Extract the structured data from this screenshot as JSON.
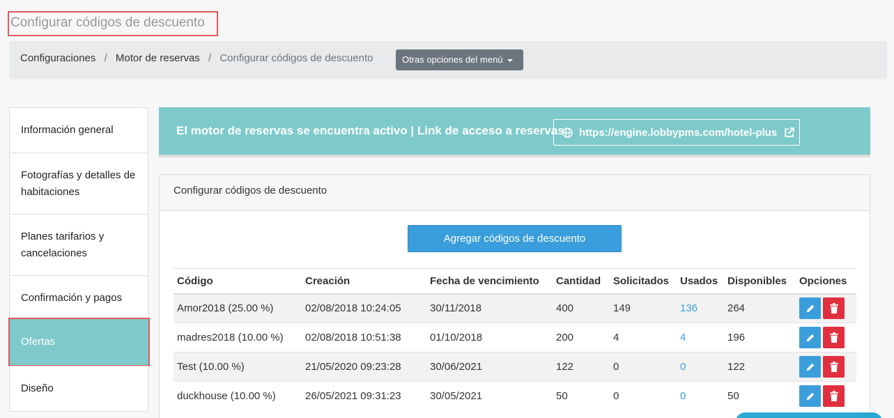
{
  "page_title": "Configurar códigos de descuento",
  "breadcrumb": {
    "items": [
      "Configuraciones",
      "Motor de reservas"
    ],
    "current": "Configurar códigos de descuento",
    "separator": "/"
  },
  "menu_button": {
    "label": "Otras opciones del menú"
  },
  "sidebar": {
    "items": [
      {
        "label": "Información general"
      },
      {
        "label": "Fotografías y detalles de habitaciones"
      },
      {
        "label": "Planes tarifarios y cancelaciones"
      },
      {
        "label": "Confirmación y pagos"
      },
      {
        "label": "Ofertas",
        "active": true
      },
      {
        "label": "Diseño"
      }
    ]
  },
  "banner": {
    "text": "El motor de reservas se encuentra activo | Link de acceso a reservas:",
    "link": "https://engine.lobbypms.com/hotel-plus"
  },
  "card": {
    "header": "Configurar códigos de descuento",
    "add_button": "Agregar códigos de descuento"
  },
  "table": {
    "columns": [
      "Código",
      "Creación",
      "Fecha de vencimiento",
      "Cantidad",
      "Solicitados",
      "Usados",
      "Disponibles",
      "Opciones"
    ],
    "rows": [
      [
        "Amor2018 (25.00 %)",
        "02/08/2018 10:24:05",
        "30/11/2018",
        "400",
        "149",
        "136",
        "264"
      ],
      [
        "madres2018 (10.00 %)",
        "02/08/2018 10:51:38",
        "01/10/2018",
        "200",
        "4",
        "4",
        "196"
      ],
      [
        "Test (10.00 %)",
        "21/05/2020 09:23:28",
        "30/06/2021",
        "122",
        "0",
        "0",
        "122"
      ],
      [
        "duckhouse (10.00 %)",
        "26/05/2021 09:31:23",
        "30/05/2021",
        "50",
        "0",
        "0",
        "50"
      ]
    ]
  },
  "colors": {
    "accent_teal": "#7ecacb",
    "primary_blue": "#3b9edc",
    "danger_red": "#e0303f",
    "highlight_red": "#e05a5a"
  }
}
